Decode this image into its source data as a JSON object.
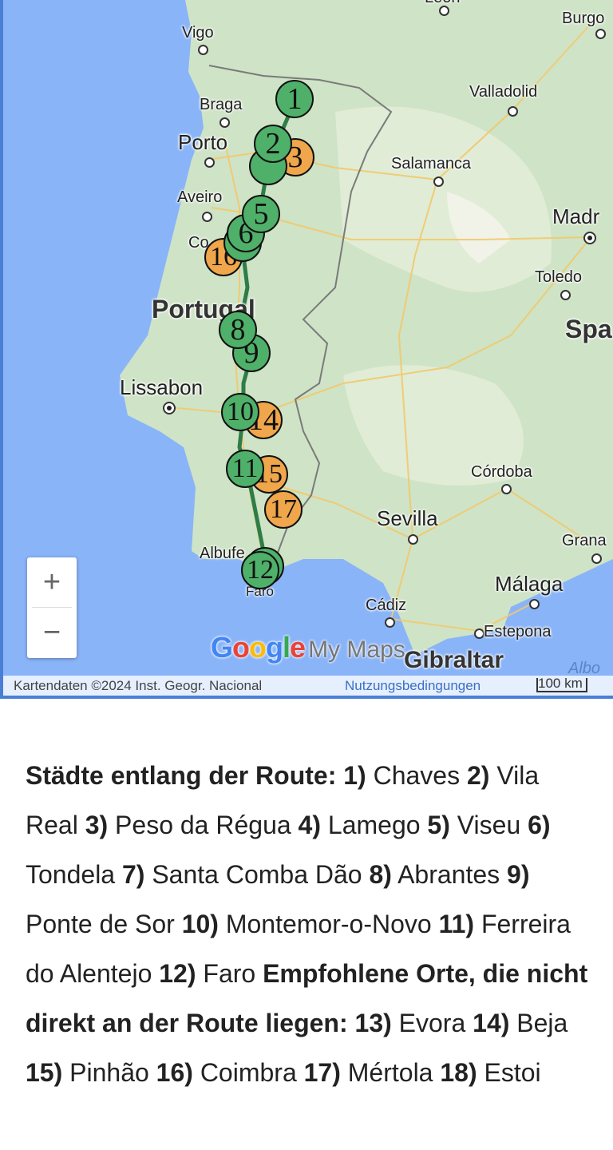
{
  "map": {
    "labels": {
      "leon": "León",
      "burgos": "Burgo",
      "vigo": "Vigo",
      "braga": "Braga",
      "porto": "Porto",
      "valladolid": "Valladolid",
      "salamanca": "Salamanca",
      "aveiro": "Aveiro",
      "madrid": "Madr",
      "coimbra": "Co",
      "toledo": "Toledo",
      "portugal": "Portugal",
      "spain": "Spa",
      "lissabon": "Lissabon",
      "cordoba": "Córdoba",
      "sevilla": "Sevilla",
      "granada": "Grana",
      "albufeira": "Albufe",
      "faro": "Faro",
      "malaga": "Málaga",
      "cadiz": "Cádiz",
      "estepona": "Estepona",
      "gibraltar": "Gibraltar",
      "alboran": "Albo"
    },
    "markers": {
      "m1": "1",
      "m2": "2",
      "m3": "3",
      "m5": "5",
      "m6": "6",
      "m16": "16",
      "m8": "8",
      "m9": "9",
      "m10": "10",
      "m14": "14",
      "m11": "11",
      "m15": "15",
      "m17": "17",
      "m12": "12"
    },
    "marker_colors": {
      "route": "#4fb06a",
      "recommended": "#f0a64b"
    },
    "route_color": "#2e7d46",
    "zoom_in": "+",
    "zoom_out": "−",
    "logo_google": "Google",
    "logo_mymaps": "My Maps",
    "attribution": "Kartendaten ©2024 Inst. Geogr. Nacional",
    "terms": "Nutzungsbedingungen",
    "scale": "100 km"
  },
  "text": {
    "h1": "Städte entlang der Route:",
    "route_items": [
      {
        "n": "1)",
        "name": "Chaves"
      },
      {
        "n": "2)",
        "name": "Vila Real"
      },
      {
        "n": "3)",
        "name": "Peso da Régua"
      },
      {
        "n": "4)",
        "name": "Lamego"
      },
      {
        "n": "5)",
        "name": "Viseu"
      },
      {
        "n": "6)",
        "name": "Tondela"
      },
      {
        "n": "7)",
        "name": "Santa Comba Dão"
      },
      {
        "n": "8)",
        "name": "Abrantes"
      },
      {
        "n": "9)",
        "name": "Ponte de Sor"
      },
      {
        "n": "10)",
        "name": "Montemor-o-Novo"
      },
      {
        "n": "11)",
        "name": "Ferreira do Alentejo"
      },
      {
        "n": "12)",
        "name": "Faro"
      }
    ],
    "h2": "Empfohlene Orte, die nicht direkt an der Route liegen:",
    "extra_items": [
      {
        "n": "13)",
        "name": "Evora"
      },
      {
        "n": "14)",
        "name": "Beja"
      },
      {
        "n": "15)",
        "name": "Pinhão"
      },
      {
        "n": "16)",
        "name": "Coimbra"
      },
      {
        "n": "17)",
        "name": "Mértola"
      },
      {
        "n": "18)",
        "name": "Estoi"
      }
    ]
  }
}
